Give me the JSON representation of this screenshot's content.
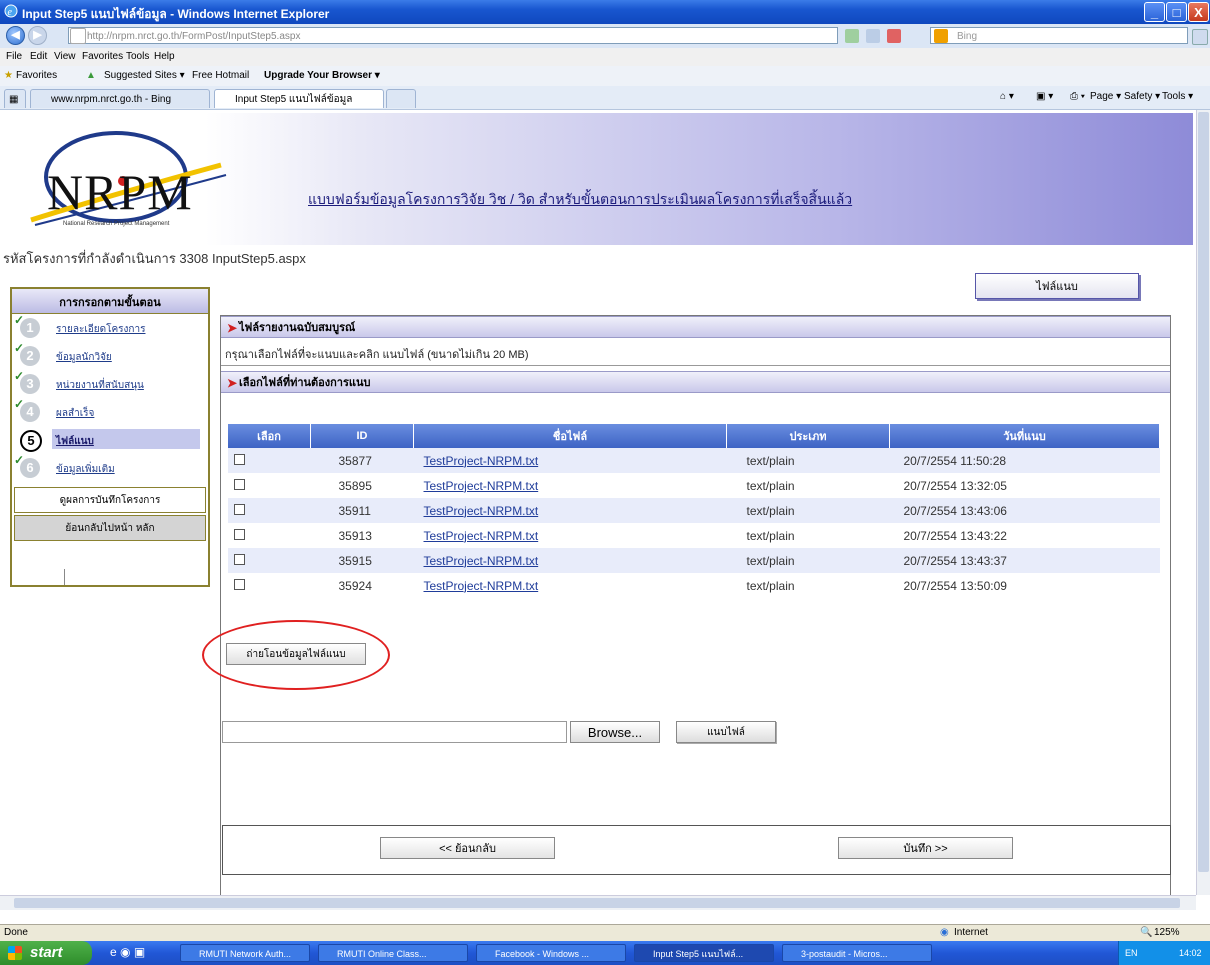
{
  "window": {
    "title": "Input Step5 แนบไฟล์ข้อมูล - Windows Internet Explorer",
    "minimize": "_",
    "maximize": "□",
    "close": "X"
  },
  "addressbar": {
    "url": "http://nrpm.nrct.go.th/FormPost/InputStep5.aspx",
    "search_engine": "Bing"
  },
  "menu": [
    "File",
    "Edit",
    "View",
    "Favorites",
    "Tools",
    "Help"
  ],
  "favorites_bar": {
    "favorites_label": "Favorites",
    "items": [
      "Suggested Sites ▾",
      "Free Hotmail",
      "Upgrade Your Browser ▾"
    ]
  },
  "tabs": [
    {
      "label": "www.nrpm.nrct.go.th - Bing"
    },
    {
      "label": "Input Step5 แนบไฟล์ข้อมูล"
    }
  ],
  "command_bar": [
    "Page ▾",
    "Safety ▾",
    "Tools ▾"
  ],
  "banner": {
    "logo": "NRPM",
    "logo_sub": "National Research Project Management",
    "title": "แบบฟอร์มข้อมูลโครงการวิจัย วิช / วิด สำหรับขั้นตอนการประเมินผลโครงการที่เสร็จสิ้นแล้ว"
  },
  "project_code": "รหัสโครงการที่กำลังดำเนินการ 3308 InputStep5.aspx",
  "attach_top_label": "ไฟล์แนบ",
  "sidebar": {
    "header": "การกรอกตามขั้นตอน",
    "steps": [
      {
        "num": "1",
        "label": "รายละเอียดโครงการ",
        "done": true
      },
      {
        "num": "2",
        "label": "ข้อมูลนักวิจัย",
        "done": true
      },
      {
        "num": "3",
        "label": "หน่วยงานที่สนับสนุน",
        "done": true
      },
      {
        "num": "4",
        "label": "ผลสำเร็จ",
        "done": true
      },
      {
        "num": "5",
        "label": "ไฟล์แนบ",
        "done": false
      },
      {
        "num": "6",
        "label": "ข้อมูลเพิ่มเติม",
        "done": true
      }
    ],
    "btn_summary": "ดูผลการบันทึกโครงการ",
    "btn_home": "ย้อนกลับไปหน้า หลัก"
  },
  "main": {
    "section1": "ไฟล์รายงานฉบับสมบูรณ์",
    "instruction": "กรุณาเลือกไฟล์ที่จะแนบและคลิก แนบไฟล์ (ขนาดไม่เกิน 20 MB)",
    "section2": "เลือกไฟล์ที่ท่านต้องการแนบ",
    "table": {
      "headers": [
        "เลือก",
        "ID",
        "ชื่อไฟล์",
        "ประเภท",
        "วันที่แนบ"
      ],
      "rows": [
        {
          "id": "35877",
          "name": "TestProject-NRPM.txt",
          "type": "text/plain",
          "date": "20/7/2554 11:50:28"
        },
        {
          "id": "35895",
          "name": "TestProject-NRPM.txt",
          "type": "text/plain",
          "date": "20/7/2554 13:32:05"
        },
        {
          "id": "35911",
          "name": "TestProject-NRPM.txt",
          "type": "text/plain",
          "date": "20/7/2554 13:43:06"
        },
        {
          "id": "35913",
          "name": "TestProject-NRPM.txt",
          "type": "text/plain",
          "date": "20/7/2554 13:43:22"
        },
        {
          "id": "35915",
          "name": "TestProject-NRPM.txt",
          "type": "text/plain",
          "date": "20/7/2554 13:43:37"
        },
        {
          "id": "35924",
          "name": "TestProject-NRPM.txt",
          "type": "text/plain",
          "date": "20/7/2554 13:50:09"
        }
      ]
    },
    "transfer_btn": "ถ่ายโอนข้อมูลไฟล์แนบ",
    "browse_btn": "Browse...",
    "attach_btn": "แนบไฟล์",
    "back_btn": "<< ย้อนกลับ",
    "save_btn": "บันทึก >>"
  },
  "statusbar": {
    "left": "Done",
    "zone": "Internet",
    "zoom": "125%"
  },
  "taskbar": {
    "start": "start",
    "tasks": [
      "RMUTI Network Auth...",
      "RMUTI Online Class...",
      "Facebook - Windows ...",
      "Input Step5 แนบไฟล์...",
      "3-postaudit - Micros..."
    ],
    "clock": "14:02",
    "lang": "EN"
  },
  "colors": {
    "titlebar": "#1856cf",
    "table_header": "#3d63c4",
    "highlight_ellipse": "#e02020",
    "sidebar_border": "#8a8130"
  }
}
